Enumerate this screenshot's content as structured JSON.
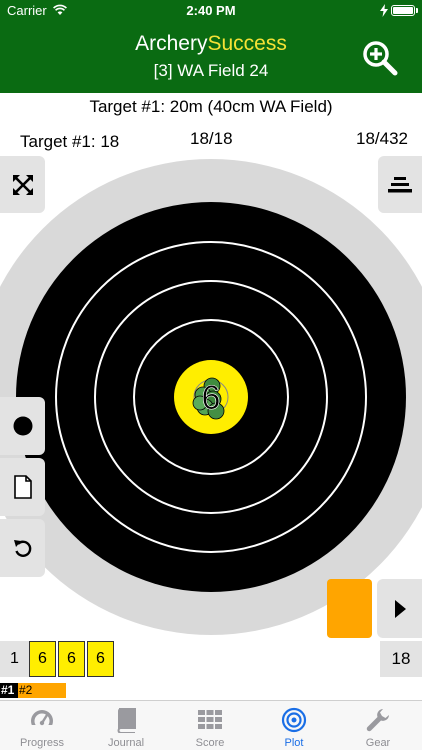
{
  "status_bar": {
    "carrier": "Carrier",
    "time": "2:40 PM"
  },
  "header": {
    "title_part1": "Archery",
    "title_part2": "Success",
    "round_name": "[3] WA Field 24",
    "zoom_icon": "zoom-in-icon"
  },
  "target_info": {
    "description": "Target #1: 20m (40cm WA Field)",
    "left": "Target #1: 18",
    "middle": "18/18",
    "right": "18/432"
  },
  "plot": {
    "arrow_label": "6"
  },
  "score_row": {
    "end_number": "1",
    "scores": [
      "6",
      "6",
      "6"
    ],
    "end_total": "18"
  },
  "target_tags": {
    "tag1": "#1",
    "tag2": "#2"
  },
  "tabs": [
    {
      "label": "Progress",
      "icon": "gauge-icon"
    },
    {
      "label": "Journal",
      "icon": "book-icon"
    },
    {
      "label": "Score",
      "icon": "grid-icon"
    },
    {
      "label": "Plot",
      "icon": "target-icon"
    },
    {
      "label": "Gear",
      "icon": "wrench-icon"
    }
  ],
  "colors": {
    "header_green": "#0a6b12",
    "title_yellow": "#f5e235",
    "score_yellow": "#ffee00",
    "orange": "#ffa500",
    "active_tab_blue": "#1a6ee6"
  }
}
